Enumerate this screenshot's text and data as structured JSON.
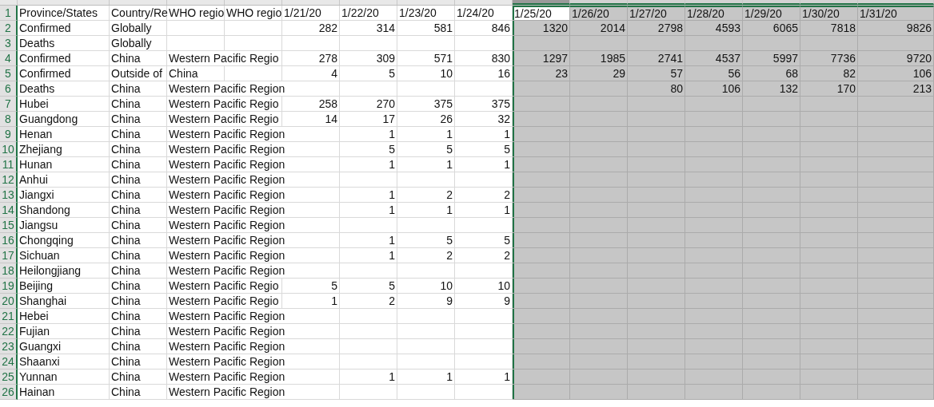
{
  "columns": [
    {
      "kind": "text",
      "selected": false,
      "active": false
    },
    {
      "kind": "text",
      "selected": false,
      "active": false
    },
    {
      "kind": "text",
      "selected": false,
      "active": false
    },
    {
      "kind": "text",
      "selected": false,
      "active": false
    },
    {
      "kind": "number",
      "selected": false,
      "active": false
    },
    {
      "kind": "number",
      "selected": false,
      "active": false
    },
    {
      "kind": "number",
      "selected": false,
      "active": false
    },
    {
      "kind": "number",
      "selected": false,
      "active": false
    },
    {
      "kind": "number",
      "selected": true,
      "active": true
    },
    {
      "kind": "number",
      "selected": true,
      "active": false
    },
    {
      "kind": "number",
      "selected": true,
      "active": false
    },
    {
      "kind": "number",
      "selected": true,
      "active": false
    },
    {
      "kind": "number",
      "selected": true,
      "active": false
    },
    {
      "kind": "number",
      "selected": true,
      "active": false
    },
    {
      "kind": "number",
      "selected": true,
      "active": false
    }
  ],
  "rows": [
    {
      "number": "1",
      "kind": "header",
      "selected": true,
      "active": true,
      "cells": [
        "Province/States",
        "Country/Re",
        "WHO regio",
        "WHO regio",
        "1/21/20",
        "1/22/20",
        "1/23/20",
        "1/24/20",
        "1/25/20",
        "1/26/20",
        "1/27/20",
        "1/28/20",
        "1/29/20",
        "1/30/20",
        "1/31/20"
      ]
    },
    {
      "number": "2",
      "kind": "data",
      "selected": true,
      "active": false,
      "cells": [
        "Confirmed",
        "Globally",
        null,
        null,
        "282",
        "314",
        "581",
        "846",
        "1320",
        "2014",
        "2798",
        "4593",
        "6065",
        "7818",
        "9826"
      ]
    },
    {
      "number": "3",
      "kind": "data",
      "selected": true,
      "active": false,
      "cells": [
        "Deaths",
        "Globally",
        null,
        null,
        null,
        null,
        null,
        null,
        null,
        null,
        null,
        null,
        null,
        null,
        null
      ]
    },
    {
      "number": "4",
      "kind": "data",
      "selected": true,
      "active": false,
      "cells": [
        "Confirmed",
        "China",
        "Western Pacific Regio",
        null,
        "278",
        "309",
        "571",
        "830",
        "1297",
        "1985",
        "2741",
        "4537",
        "5997",
        "7736",
        "9720"
      ]
    },
    {
      "number": "5",
      "kind": "data",
      "selected": true,
      "active": false,
      "cells": [
        "Confirmed",
        "Outside of",
        "China",
        null,
        "4",
        "5",
        "10",
        "16",
        "23",
        "29",
        "57",
        "56",
        "68",
        "82",
        "106"
      ]
    },
    {
      "number": "6",
      "kind": "data",
      "selected": true,
      "active": false,
      "cells": [
        "Deaths",
        "China",
        "Western Pacific Region",
        null,
        null,
        null,
        null,
        null,
        null,
        null,
        "80",
        "106",
        "132",
        "170",
        "213"
      ]
    },
    {
      "number": "7",
      "kind": "data",
      "selected": true,
      "active": false,
      "cells": [
        "Hubei",
        "China",
        "Western Pacific Regio",
        null,
        "258",
        "270",
        "375",
        "375",
        null,
        null,
        null,
        null,
        null,
        null,
        null
      ]
    },
    {
      "number": "8",
      "kind": "data",
      "selected": true,
      "active": false,
      "cells": [
        "Guangdong",
        "China",
        "Western Pacific Regio",
        null,
        "14",
        "17",
        "26",
        "32",
        null,
        null,
        null,
        null,
        null,
        null,
        null
      ]
    },
    {
      "number": "9",
      "kind": "data",
      "selected": true,
      "active": false,
      "cells": [
        "Henan",
        "China",
        "Western Pacific Region",
        null,
        null,
        "1",
        "1",
        "1",
        null,
        null,
        null,
        null,
        null,
        null,
        null
      ]
    },
    {
      "number": "10",
      "kind": "data",
      "selected": true,
      "active": false,
      "cells": [
        "Zhejiang",
        "China",
        "Western Pacific Region",
        null,
        null,
        "5",
        "5",
        "5",
        null,
        null,
        null,
        null,
        null,
        null,
        null
      ]
    },
    {
      "number": "11",
      "kind": "data",
      "selected": true,
      "active": false,
      "cells": [
        "Hunan",
        "China",
        "Western Pacific Region",
        null,
        null,
        "1",
        "1",
        "1",
        null,
        null,
        null,
        null,
        null,
        null,
        null
      ]
    },
    {
      "number": "12",
      "kind": "data",
      "selected": true,
      "active": false,
      "cells": [
        "Anhui",
        "China",
        "Western Pacific Region",
        null,
        null,
        null,
        null,
        null,
        null,
        null,
        null,
        null,
        null,
        null,
        null
      ]
    },
    {
      "number": "13",
      "kind": "data",
      "selected": true,
      "active": false,
      "cells": [
        "Jiangxi",
        "China",
        "Western Pacific Region",
        null,
        null,
        "1",
        "2",
        "2",
        null,
        null,
        null,
        null,
        null,
        null,
        null
      ]
    },
    {
      "number": "14",
      "kind": "data",
      "selected": true,
      "active": false,
      "cells": [
        "Shandong",
        "China",
        "Western Pacific Region",
        null,
        null,
        "1",
        "1",
        "1",
        null,
        null,
        null,
        null,
        null,
        null,
        null
      ]
    },
    {
      "number": "15",
      "kind": "data",
      "selected": true,
      "active": false,
      "cells": [
        "Jiangsu",
        "China",
        "Western Pacific Region",
        null,
        null,
        null,
        null,
        null,
        null,
        null,
        null,
        null,
        null,
        null,
        null
      ]
    },
    {
      "number": "16",
      "kind": "data",
      "selected": true,
      "active": false,
      "cells": [
        "Chongqing",
        "China",
        "Western Pacific Region",
        null,
        null,
        "1",
        "5",
        "5",
        null,
        null,
        null,
        null,
        null,
        null,
        null
      ]
    },
    {
      "number": "17",
      "kind": "data",
      "selected": true,
      "active": false,
      "cells": [
        "Sichuan",
        "China",
        "Western Pacific Region",
        null,
        null,
        "1",
        "2",
        "2",
        null,
        null,
        null,
        null,
        null,
        null,
        null
      ]
    },
    {
      "number": "18",
      "kind": "data",
      "selected": true,
      "active": false,
      "cells": [
        "Heilongjiang",
        "China",
        "Western Pacific Region",
        null,
        null,
        null,
        null,
        null,
        null,
        null,
        null,
        null,
        null,
        null,
        null
      ]
    },
    {
      "number": "19",
      "kind": "data",
      "selected": true,
      "active": false,
      "cells": [
        "Beijing",
        "China",
        "Western Pacific Regio",
        null,
        "5",
        "5",
        "10",
        "10",
        null,
        null,
        null,
        null,
        null,
        null,
        null
      ]
    },
    {
      "number": "20",
      "kind": "data",
      "selected": true,
      "active": false,
      "cells": [
        "Shanghai",
        "China",
        "Western Pacific Regio",
        null,
        "1",
        "2",
        "9",
        "9",
        null,
        null,
        null,
        null,
        null,
        null,
        null
      ]
    },
    {
      "number": "21",
      "kind": "data",
      "selected": true,
      "active": false,
      "cells": [
        "Hebei",
        "China",
        "Western Pacific Region",
        null,
        null,
        null,
        null,
        null,
        null,
        null,
        null,
        null,
        null,
        null,
        null
      ]
    },
    {
      "number": "22",
      "kind": "data",
      "selected": true,
      "active": false,
      "cells": [
        "Fujian",
        "China",
        "Western Pacific Region",
        null,
        null,
        null,
        null,
        null,
        null,
        null,
        null,
        null,
        null,
        null,
        null
      ]
    },
    {
      "number": "23",
      "kind": "data",
      "selected": true,
      "active": false,
      "cells": [
        "Guangxi",
        "China",
        "Western Pacific Region",
        null,
        null,
        null,
        null,
        null,
        null,
        null,
        null,
        null,
        null,
        null,
        null
      ]
    },
    {
      "number": "24",
      "kind": "data",
      "selected": true,
      "active": false,
      "cells": [
        "Shaanxi",
        "China",
        "Western Pacific Region",
        null,
        null,
        null,
        null,
        null,
        null,
        null,
        null,
        null,
        null,
        null,
        null
      ]
    },
    {
      "number": "25",
      "kind": "data",
      "selected": true,
      "active": false,
      "cells": [
        "Yunnan",
        "China",
        "Western Pacific Region",
        null,
        null,
        "1",
        "1",
        "1",
        null,
        null,
        null,
        null,
        null,
        null,
        null
      ]
    },
    {
      "number": "26",
      "kind": "data",
      "selected": true,
      "active": false,
      "cells": [
        "Hainan",
        "China",
        "Western Pacific Region",
        null,
        null,
        null,
        null,
        null,
        null,
        null,
        null,
        null,
        null,
        null,
        null
      ]
    }
  ]
}
